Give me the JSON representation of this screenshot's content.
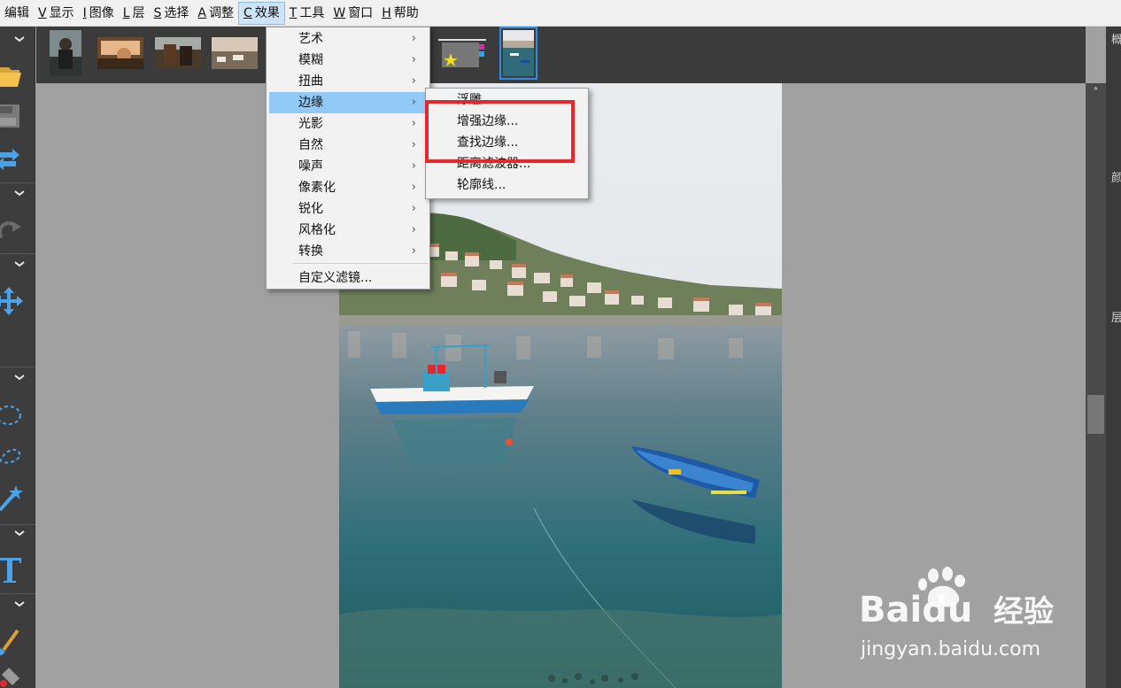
{
  "menubar": {
    "items": [
      {
        "key": "",
        "label": "编辑"
      },
      {
        "key": "V",
        "label": "显示"
      },
      {
        "key": "I",
        "label": "图像"
      },
      {
        "key": "L",
        "label": "层"
      },
      {
        "key": "S",
        "label": "选择"
      },
      {
        "key": "A",
        "label": "调整"
      },
      {
        "key": "C",
        "label": "效果"
      },
      {
        "key": "T",
        "label": "工具"
      },
      {
        "key": "W",
        "label": "窗口"
      },
      {
        "key": "H",
        "label": "帮助"
      }
    ],
    "active_index": 6
  },
  "effects_menu": {
    "items": [
      {
        "label": "艺术",
        "submenu": true
      },
      {
        "label": "模糊",
        "submenu": true
      },
      {
        "label": "扭曲",
        "submenu": true
      },
      {
        "label": "边缘",
        "submenu": true,
        "highlighted": true
      },
      {
        "label": "光影",
        "submenu": true
      },
      {
        "label": "自然",
        "submenu": true
      },
      {
        "label": "噪声",
        "submenu": true
      },
      {
        "label": "像素化",
        "submenu": true
      },
      {
        "label": "锐化",
        "submenu": true
      },
      {
        "label": "风格化",
        "submenu": true
      },
      {
        "label": "转换",
        "submenu": true
      }
    ],
    "custom_filter": "自定义滤镜...",
    "arrow_glyph": "›"
  },
  "edge_submenu": {
    "items": [
      "浮雕",
      "增强边缘...",
      "查找边缘...",
      "距离滤波器...",
      "轮廓线..."
    ],
    "emphasized": [
      "增强边缘...",
      "查找边缘..."
    ]
  },
  "thumbnails": [
    {
      "name": "thumb-person-portrait",
      "selected": false
    },
    {
      "name": "thumb-car-interior",
      "selected": false
    },
    {
      "name": "thumb-horses",
      "selected": false
    },
    {
      "name": "thumb-hillside-town",
      "selected": false
    },
    {
      "name": "thumb-new-image",
      "selected": false
    },
    {
      "name": "thumb-harbor-boats",
      "selected": true
    }
  ],
  "right_panel_chars": [
    "概",
    "颜",
    "层"
  ],
  "watermark": {
    "brand": "Baidu",
    "suffix": "经验",
    "url": "jingyan.baidu.com"
  },
  "colors": {
    "menu_highlight": "#91c9f7",
    "menubar_active": "#cde3f7",
    "annotation_red": "#e8262e",
    "selection_blue": "#2e8ce6",
    "toolbar_blue": "#4aa3e8"
  }
}
